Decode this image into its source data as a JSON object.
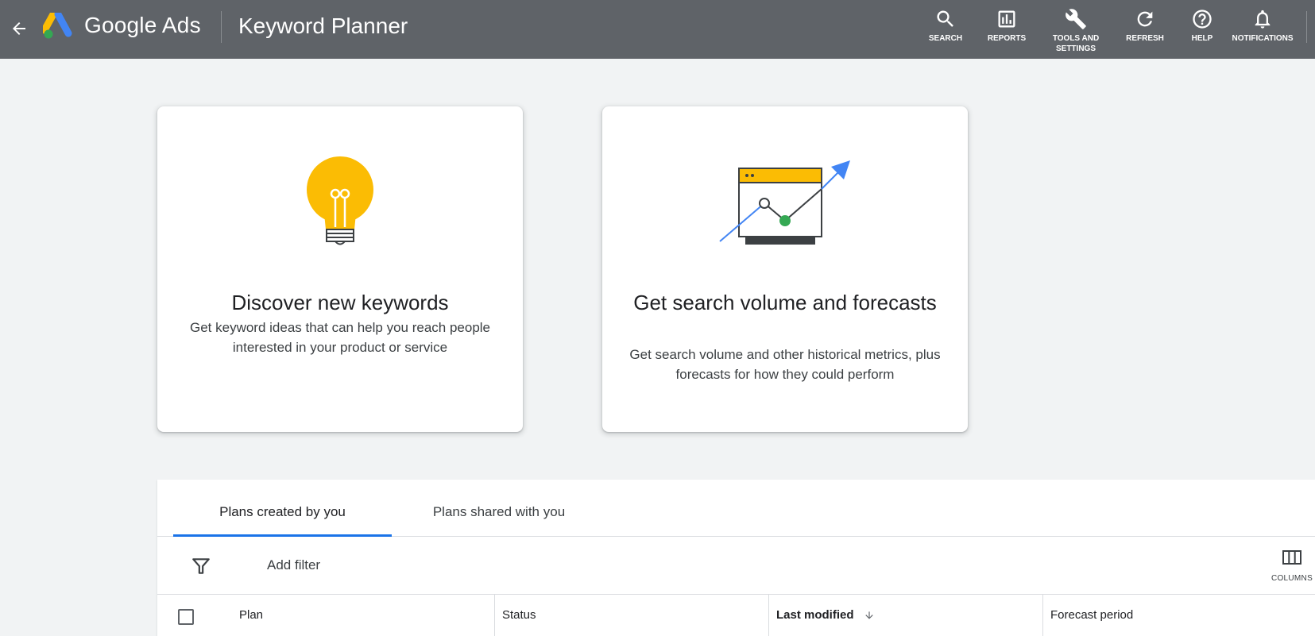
{
  "header": {
    "brand": "Google Ads",
    "page_title": "Keyword Planner",
    "tools": [
      {
        "label": "SEARCH",
        "icon": "search-icon"
      },
      {
        "label": "REPORTS",
        "icon": "reports-icon"
      },
      {
        "label": "TOOLS AND SETTINGS",
        "icon": "wrench-icon"
      },
      {
        "label": "REFRESH",
        "icon": "refresh-icon"
      },
      {
        "label": "HELP",
        "icon": "help-icon"
      },
      {
        "label": "NOTIFICATIONS",
        "icon": "bell-icon"
      }
    ]
  },
  "cards": [
    {
      "title": "Discover new keywords",
      "description": "Get keyword ideas that can help you reach people interested in your product or service",
      "icon": "lightbulb-icon"
    },
    {
      "title": "Get search volume and forecasts",
      "description": "Get search volume and other historical metrics, plus forecasts for how they could perform",
      "icon": "forecast-chart-icon"
    }
  ],
  "plans": {
    "tabs": [
      {
        "label": "Plans created by you",
        "active": true
      },
      {
        "label": "Plans shared with you",
        "active": false
      }
    ],
    "add_filter_label": "Add filter",
    "columns_label": "COLUMNS",
    "table_headers": {
      "plan": "Plan",
      "status": "Status",
      "last_modified": "Last modified",
      "forecast_period": "Forecast period"
    }
  },
  "colors": {
    "topbar": "#5f6368",
    "accent": "#1a73e8",
    "bulb": "#fbbc04",
    "chart_arrow": "#4285f4",
    "chart_dot": "#34a853"
  }
}
